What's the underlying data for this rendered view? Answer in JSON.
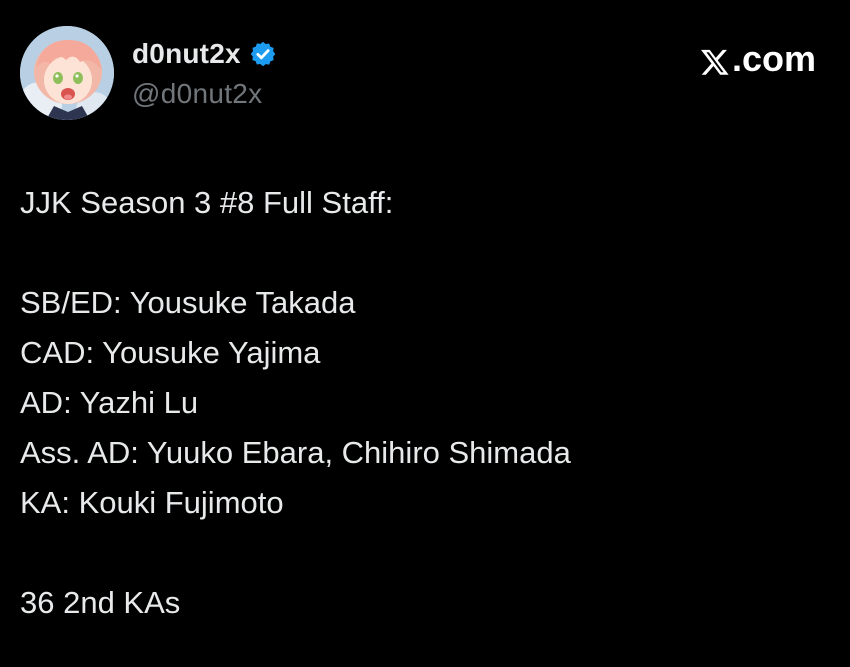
{
  "author": {
    "display_name": "d0nut2x",
    "handle": "@d0nut2x",
    "verified": true,
    "avatar_icon": "anime-avatar-icon",
    "verified_color": "#1d9bf0"
  },
  "brand": {
    "icon": "x-logo-icon",
    "label": ".com"
  },
  "post": {
    "title_line": "JJK Season 3 #8 Full Staff:",
    "staff_lines": [
      "SB/ED: Yousuke Takada",
      "CAD: Yousuke Yajima",
      "AD: Yazhi Lu",
      "Ass. AD: Yuuko Ebara, Chihiro Shimada",
      "KA: Kouki Fujimoto"
    ],
    "footer_line": "36 2nd KAs"
  },
  "colors": {
    "background": "#000000",
    "text": "#e7e9ea",
    "secondary_text": "#71767b"
  }
}
